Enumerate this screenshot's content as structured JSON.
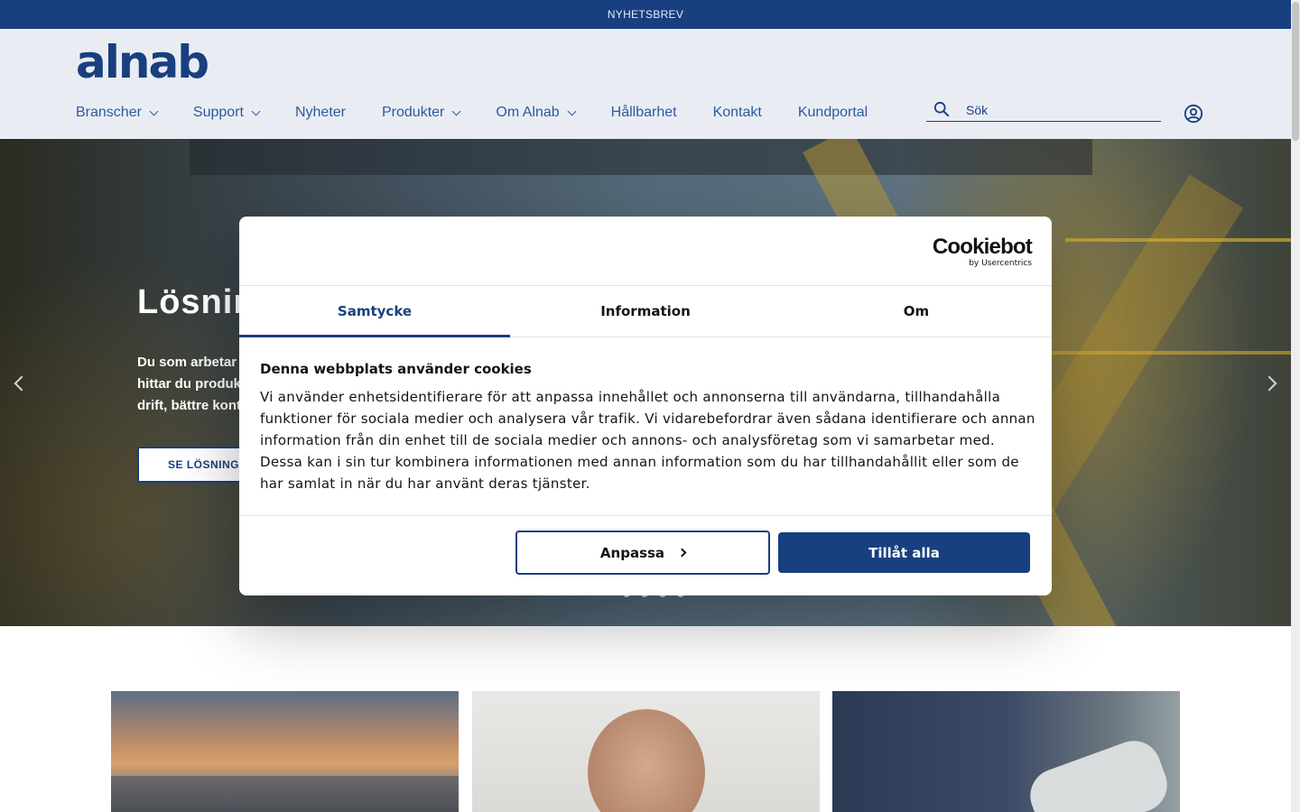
{
  "topbar": {
    "newsletter_link": "NYHETSBREV"
  },
  "header": {
    "logo_text": "alnab",
    "nav": [
      {
        "label": "Branscher",
        "has_dropdown": true
      },
      {
        "label": "Support",
        "has_dropdown": true
      },
      {
        "label": "Nyheter",
        "has_dropdown": false
      },
      {
        "label": "Produkter",
        "has_dropdown": true
      },
      {
        "label": "Om Alnab",
        "has_dropdown": true
      },
      {
        "label": "Hållbarhet",
        "has_dropdown": false
      },
      {
        "label": "Kontakt",
        "has_dropdown": false
      },
      {
        "label": "Kundportal",
        "has_dropdown": false
      }
    ],
    "search": {
      "placeholder": "Sök",
      "icon": "search-icon"
    },
    "user_icon": "user-icon"
  },
  "hero": {
    "title": "Lösnin",
    "text_lines": [
      "Du som arbetar",
      "hittar du produk",
      "drift, bättre kont"
    ],
    "button_label": "SE LÖSNINGA",
    "slide_count": 4
  },
  "cookie_dialog": {
    "provider_brand": "Cookiebot",
    "provider_sub": "by Usercentrics",
    "tabs": [
      {
        "label": "Samtycke",
        "active": true
      },
      {
        "label": "Information",
        "active": false
      },
      {
        "label": "Om",
        "active": false
      }
    ],
    "heading": "Denna webbplats använder cookies",
    "body": "Vi använder enhetsidentifierare för att anpassa innehållet och annonserna till användarna, tillhandahålla funktioner för sociala medier och analysera vår trafik. Vi vidarebefordrar även sådana identifierare och annan information från din enhet till de sociala medier och annons- och analysföretag som vi samarbetar med. Dessa kan i sin tur kombinera informationen med annan information som du har tillhandahållit eller som de har samlat in när du har använt deras tjänster.",
    "customize_label": "Anpassa",
    "allow_all_label": "Tillåt alla"
  },
  "colors": {
    "brand": "#183f7f",
    "header_bg": "#e9edf3",
    "nav_text": "#2c5aa0"
  }
}
